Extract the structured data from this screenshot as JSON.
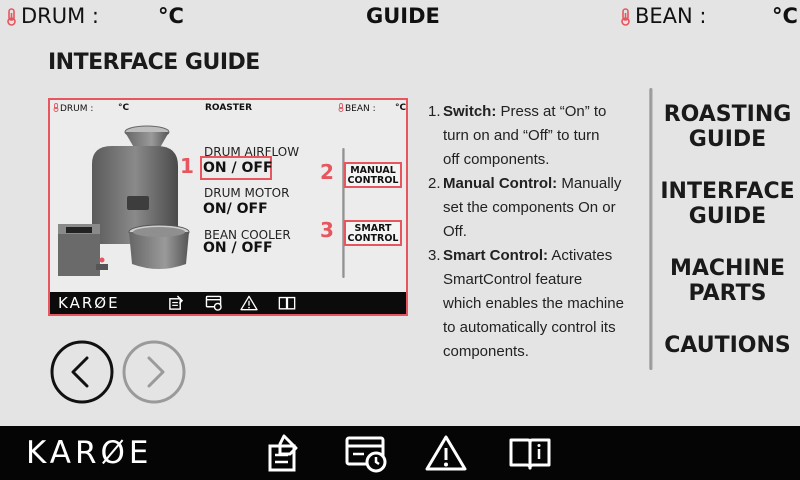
{
  "status_bar": {
    "drum_label": "DRUM :",
    "drum_unit": "°C",
    "title": "GUIDE",
    "bean_label": "BEAN :",
    "bean_unit": "°C"
  },
  "page_title": "INTERFACE GUIDE",
  "preview": {
    "drum_label": "DRUM :",
    "drum_unit": "°C",
    "title": "ROASTER",
    "bean_label": "BEAN :",
    "bean_unit": "°C",
    "controls": [
      {
        "number": "1",
        "label": "DRUM AIRFLOW",
        "value": "ON / OFF"
      },
      {
        "label": "DRUM MOTOR",
        "value": "ON/ OFF"
      },
      {
        "label": "BEAN COOLER",
        "value": "ON / OFF"
      }
    ],
    "buttons": [
      {
        "number": "2",
        "line1": "MANUAL",
        "line2": "CONTROL"
      },
      {
        "number": "3",
        "line1": "SMART",
        "line2": "CONTROL"
      }
    ],
    "logo": "KARØE"
  },
  "instructions": [
    {
      "num": "1.",
      "term": "Switch:",
      "text_lines": [
        " Press at “On” to",
        "turn on and “Off” to turn",
        "off components."
      ]
    },
    {
      "num": "2.",
      "term": "Manual Control:",
      "text_lines": [
        " Manually",
        "set the components On or",
        "Off."
      ]
    },
    {
      "num": "3.",
      "term": "Smart Control:",
      "text_lines": [
        " Activates",
        "SmartControl feature",
        "which enables the machine",
        "to automatically control its",
        "components."
      ]
    }
  ],
  "right_nav": [
    {
      "line1": "ROASTING",
      "line2": "GUIDE"
    },
    {
      "line1": "INTERFACE",
      "line2": "GUIDE"
    },
    {
      "line1": "MACHINE",
      "line2": "PARTS"
    },
    {
      "line1": "CAUTIONS",
      "line2": ""
    }
  ],
  "footer": {
    "logo": "KARØE",
    "icons": [
      "roast-log-icon",
      "payment-history-icon",
      "warning-icon",
      "guide-book-icon"
    ]
  },
  "colors": {
    "accent": "#e7555e",
    "bar": "#050505",
    "background": "#e4e4e4"
  }
}
